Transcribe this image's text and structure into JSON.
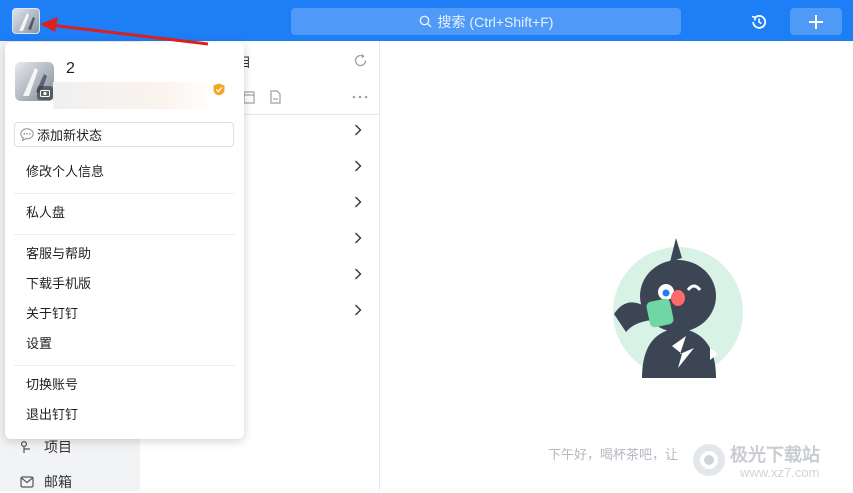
{
  "topbar": {
    "search_placeholder": "搜索 (Ctrl+Shift+F)",
    "color": "#1e7ef5"
  },
  "profile": {
    "name": "2",
    "status_button": "添加新状态"
  },
  "menu": {
    "edit_profile": "修改个人信息",
    "private_disk": "私人盘",
    "support": "客服与帮助",
    "download_mobile": "下载手机版",
    "about": "关于钉钉",
    "settings": "设置",
    "switch_account": "切换账号",
    "logout": "退出钉钉"
  },
  "middle": {
    "header_partial": "目"
  },
  "sidebar": {
    "items": [
      {
        "label": "项目",
        "icon": "project-icon"
      },
      {
        "label": "邮箱",
        "icon": "mail-icon"
      }
    ]
  },
  "empty_state": {
    "message": "下午好，喝杯茶吧，让"
  },
  "watermark": {
    "brand": "极光下载站",
    "url": "www.xz7.com"
  }
}
